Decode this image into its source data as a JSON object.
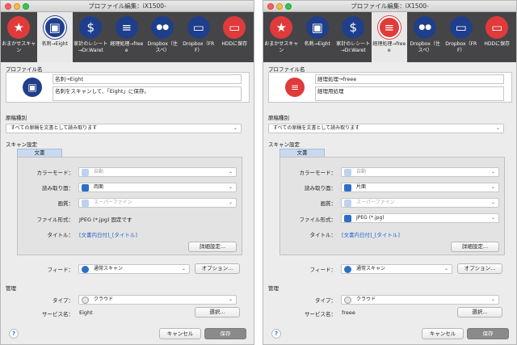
{
  "windows": [
    {
      "title": "プロファイル編集：iX1500-",
      "toolbar": [
        {
          "label": "おまかせスキャン",
          "icon": "star-icon",
          "glyph": "★",
          "color": "#e03a3a",
          "selected": false
        },
        {
          "label": "名刺→Eight",
          "icon": "business-card-icon",
          "glyph": "▣",
          "color": "#1f3f8c",
          "selected": true
        },
        {
          "label": "家計のレシート→Dr.Waret",
          "icon": "receipt-icon",
          "glyph": "$",
          "color": "#1f3f8c",
          "selected": false
        },
        {
          "label": "経理処理→freee",
          "icon": "coins-icon",
          "glyph": "≡",
          "color": "#1f3f8c",
          "selected": false
        },
        {
          "label": "Dropbox（住スペ）",
          "icon": "people-icon",
          "glyph": "●●",
          "color": "#1f3f8c",
          "selected": false
        },
        {
          "label": "Dropbox（FRF）",
          "icon": "folder-icon",
          "glyph": "▭",
          "color": "#1f3f8c",
          "selected": false
        },
        {
          "label": "HDDに保存",
          "icon": "folder-icon",
          "glyph": "▭",
          "color": "#e03a3a",
          "selected": false
        }
      ],
      "profile_section": "プロファイル名",
      "profile_icon": {
        "icon": "business-card-icon",
        "glyph": "▣",
        "color": "#1f3f8c"
      },
      "profile_name": "名刺→Eight",
      "profile_desc": "名刺をスキャンして、「Eight」に保存。",
      "doc_type_section": "原稿種別",
      "doc_type": "すべての原稿を文書として読み取ります",
      "scan_section": "スキャン設定",
      "tab": "文書",
      "color_mode_label": "カラーモード：",
      "color_mode": "自動",
      "color_mode_disabled": true,
      "side_label": "読み取り面：",
      "side": "両面",
      "side_disabled": false,
      "quality_label": "画質：",
      "quality": "スーパーファイン",
      "quality_disabled": true,
      "format_label": "ファイル形式：",
      "format": "JPEG (*.jpg) 固定です",
      "format_select": false,
      "filename_label": "タイトル：",
      "filename": "[文書内日付]_[タイトル]",
      "detail_button": "詳細設定...",
      "feed_label": "フィード：",
      "feed": "通常スキャン",
      "options_button": "オプション...",
      "manage_section": "管理",
      "type_label": "タイプ：",
      "type": "クラウド",
      "service_label": "サービス名：",
      "service": "Eight",
      "select_button": "選択...",
      "cancel_button": "キャンセル",
      "save_button": "保存"
    },
    {
      "title": "プロファイル編集：iX1500-",
      "toolbar": [
        {
          "label": "おまかせスキャン",
          "icon": "star-icon",
          "glyph": "★",
          "color": "#e03a3a",
          "selected": false
        },
        {
          "label": "名刺→Eight",
          "icon": "business-card-icon",
          "glyph": "▣",
          "color": "#1f3f8c",
          "selected": false
        },
        {
          "label": "家計のレシート→Dr.Waret",
          "icon": "receipt-icon",
          "glyph": "$",
          "color": "#1f3f8c",
          "selected": false
        },
        {
          "label": "経理処理→freee",
          "icon": "coins-icon",
          "glyph": "≡",
          "color": "#e03a3a",
          "selected": true
        },
        {
          "label": "Dropbox（住スペ）",
          "icon": "people-icon",
          "glyph": "●●",
          "color": "#1f3f8c",
          "selected": false
        },
        {
          "label": "Dropbox（FRF）",
          "icon": "folder-icon",
          "glyph": "▭",
          "color": "#1f3f8c",
          "selected": false
        },
        {
          "label": "HDDに保存",
          "icon": "folder-icon",
          "glyph": "▭",
          "color": "#e03a3a",
          "selected": false
        }
      ],
      "profile_section": "プロファイル名",
      "profile_icon": {
        "icon": "coins-icon",
        "glyph": "≡",
        "color": "#e03a3a"
      },
      "profile_name": "経理処理→freee",
      "profile_desc": "経理用処理",
      "doc_type_section": "原稿種別",
      "doc_type": "すべての原稿を文書として読み取ります",
      "scan_section": "スキャン設定",
      "tab": "文書",
      "color_mode_label": "カラーモード：",
      "color_mode": "自動",
      "color_mode_disabled": true,
      "side_label": "読み取り面：",
      "side": "片面",
      "side_disabled": false,
      "quality_label": "画質：",
      "quality": "スーパーファイン",
      "quality_disabled": true,
      "format_label": "ファイル形式：",
      "format": "JPEG (*.jpg)",
      "format_select": true,
      "filename_label": "タイトル：",
      "filename": "[文書内日付]_[タイトル]",
      "detail_button": "詳細設定...",
      "feed_label": "フィード：",
      "feed": "通常スキャン",
      "options_button": "オプション...",
      "manage_section": "管理",
      "type_label": "タイプ：",
      "type": "クラウド",
      "service_label": "サービス名：",
      "service": "freee",
      "select_button": "選択...",
      "cancel_button": "キャンセル",
      "save_button": "保存"
    }
  ],
  "help_glyph": "?"
}
